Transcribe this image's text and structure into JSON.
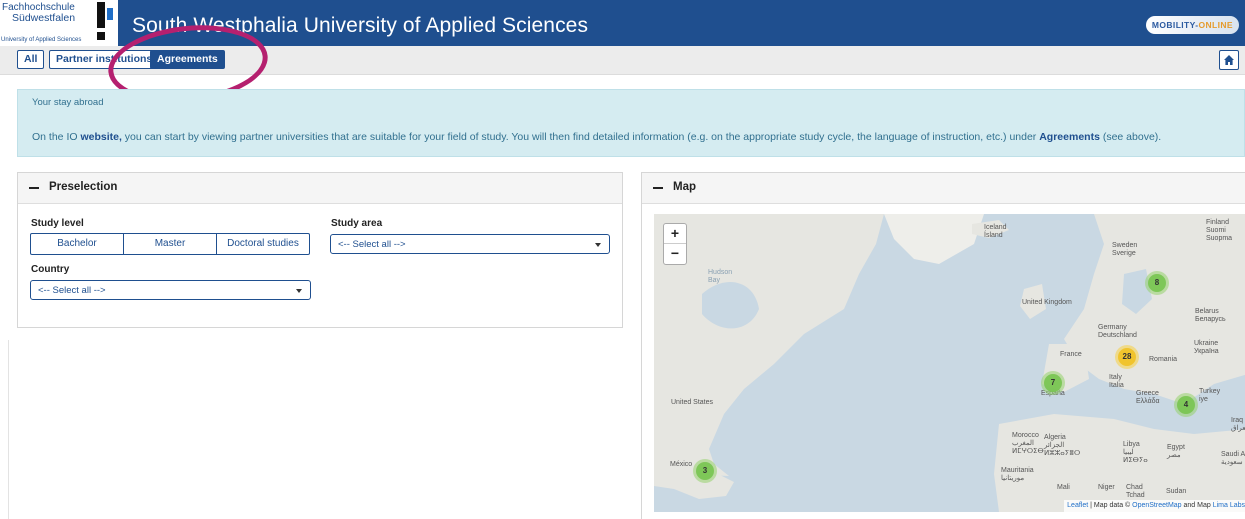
{
  "header": {
    "logo_line1": "Fachhochschule",
    "logo_line2": "Südwestfalen",
    "logo_line3": "University of Applied Sciences",
    "title": "South Westphalia University of Applied Sciences",
    "badge_main": "MOBILITY-",
    "badge_accent": "ONLINE"
  },
  "nav": {
    "tabs": [
      {
        "label": "All"
      },
      {
        "label": "Partner institutions"
      },
      {
        "label": "Agreements"
      }
    ],
    "home_icon": "home-icon"
  },
  "info": {
    "title": "Your stay abroad",
    "text_before": "On the IO ",
    "link": "website,",
    "text_middle": " you can start by viewing partner universities that are suitable for your field of study. You will then find detailed information (e.g. on the appropriate study cycle, the language of instruction, etc.) under ",
    "bold": "Agreements",
    "text_after": " (see above)."
  },
  "preselection": {
    "title": "Preselection",
    "study_level_label": "Study level",
    "study_levels": [
      "Bachelor",
      "Master",
      "Doctoral studies"
    ],
    "study_area_label": "Study area",
    "study_area_value": "<-- Select all -->",
    "country_label": "Country",
    "country_value": "<-- Select all -->"
  },
  "map": {
    "title": "Map",
    "zoom_in": "+",
    "zoom_out": "−",
    "clusters": [
      {
        "count": "8",
        "color": "green"
      },
      {
        "count": "28",
        "color": "yellow"
      },
      {
        "count": "7",
        "color": "green"
      },
      {
        "count": "4",
        "color": "green"
      },
      {
        "count": "3",
        "color": "green"
      }
    ],
    "labels": {
      "iceland": "Iceland\nÍsland",
      "finland": "Finland\nSuomi\nSuopma",
      "sweden": "Sweden\nSverige",
      "hudson": "Hudson\nBay",
      "uk": "United Kingdom",
      "belarus": "Belarus\nБеларусь",
      "germany": "Germany\nDeutschland",
      "ukraine": "Ukraine\nУкраїна",
      "france": "France",
      "romania": "Romania",
      "italy": "Italy\nItalia",
      "espana": "España",
      "greece": "Greece\nΕλλάδα",
      "turkey": "Turkey\niye",
      "us": "United States",
      "iraq": "Iraq\nالعراق",
      "morocco": "Morocco\nالمغرب\nⵍⵎⵖⵔⵉⴱ",
      "algeria": "Algeria\nالجزائر\nⵍⵣⵣⴰⵢⴻⵔ",
      "libya": "Libya\nليبيا\nⵍⵉⴱⵢⴰ",
      "egypt": "Egypt\nمصر",
      "saudi": "Saudi A\nسعودية",
      "mexico": "México",
      "mauritania": "Mauritania\nموريتانيا",
      "mali": "Mali",
      "niger": "Niger",
      "chad": "Chad\nTchad",
      "sudan": "Sudan"
    },
    "attribution_leaflet": "Leaflet",
    "attribution_text": " | Map data © ",
    "attribution_osm": "OpenStreetMap",
    "attribution_and": " and Map ",
    "attribution_lima": "Lima Labs"
  },
  "colors": {
    "brand": "#1f4f8f",
    "info_bg": "#d5ecf1",
    "annotation": "#b5206f",
    "cluster_green": "#78c450",
    "cluster_yellow": "#f0c328"
  }
}
